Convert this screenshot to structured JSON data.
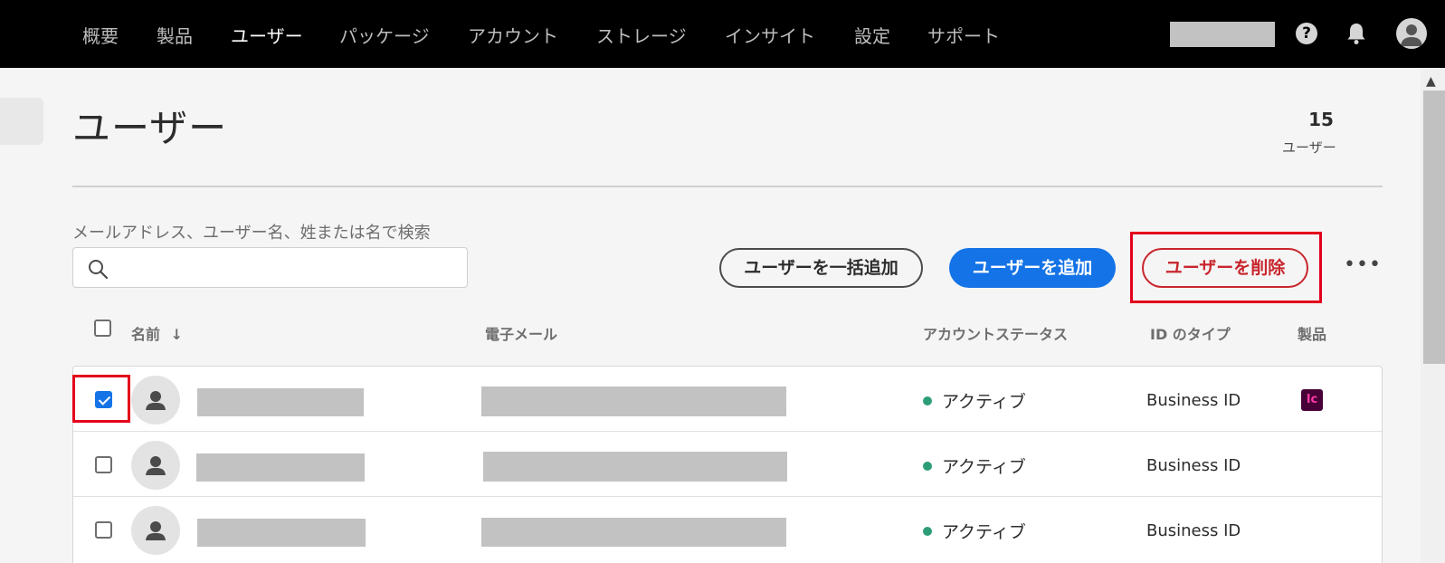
{
  "nav": {
    "items": [
      {
        "label": "概要"
      },
      {
        "label": "製品"
      },
      {
        "label": "ユーザー",
        "active": true
      },
      {
        "label": "パッケージ"
      },
      {
        "label": "アカウント"
      },
      {
        "label": "ストレージ"
      },
      {
        "label": "インサイト"
      },
      {
        "label": "設定"
      },
      {
        "label": "サポート"
      }
    ],
    "help_glyph": "?"
  },
  "page": {
    "title": "ユーザー",
    "count": "15",
    "count_label": "ユーザー"
  },
  "search": {
    "label": "メールアドレス、ユーザー名、姓または名で検索",
    "value": "",
    "placeholder": ""
  },
  "actions": {
    "bulk_add": "ユーザーを一括追加",
    "add": "ユーザーを追加",
    "delete": "ユーザーを削除",
    "more": "•••"
  },
  "table": {
    "headers": {
      "name": "名前",
      "email": "電子メール",
      "status": "アカウントステータス",
      "idtype": "ID のタイプ",
      "products": "製品"
    },
    "sort_indicator": "↓",
    "rows": [
      {
        "checked": true,
        "status": "アクティブ",
        "idtype": "Business ID",
        "product": "Ic"
      },
      {
        "checked": false,
        "status": "アクティブ",
        "idtype": "Business ID",
        "product": ""
      },
      {
        "checked": false,
        "status": "アクティブ",
        "idtype": "Business ID",
        "product": ""
      }
    ]
  },
  "colors": {
    "accent": "#1473e6",
    "danger": "#c9252d",
    "status_active": "#2d9d78",
    "highlight": "#e3001b"
  }
}
